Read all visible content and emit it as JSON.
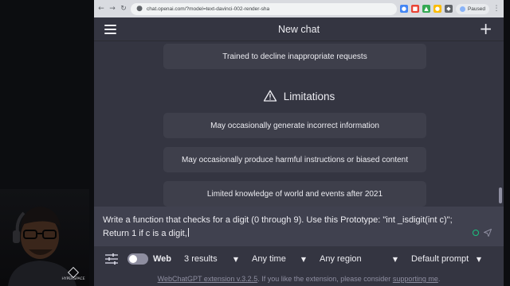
{
  "browser": {
    "url": "chat.openai.com/?model=text-davinci-002-render-sha",
    "profile_status": "Paused"
  },
  "header": {
    "title": "New chat"
  },
  "capabilities": {
    "last_item": "Trained to decline inappropriate requests"
  },
  "limitations": {
    "heading": "Limitations",
    "items": [
      "May occasionally generate incorrect information",
      "May occasionally produce harmful instructions or biased content",
      "Limited knowledge of world and events after 2021"
    ]
  },
  "prompt": {
    "text_line1": "Write a function that checks for a digit (0 through 9). Use this Prototype: \"int _isdigit(int c)\";",
    "text_line2": "Return 1 if c is a digit,"
  },
  "toolbar": {
    "web_label": "Web",
    "results": "3 results",
    "time": "Any time",
    "region": "Any region",
    "prompt_mode": "Default prompt"
  },
  "footer": {
    "link_extension": "WebChatGPT extension v.3.2.5",
    "middle_text": ". If you like the extension, please consider ",
    "link_support": "supporting me",
    "end_text": "."
  },
  "watermark": {
    "text": "HYPERSPACE"
  },
  "colors": {
    "page_bg": "#343541",
    "card_bg": "#3e3f4b",
    "prompt_bg": "#40414f",
    "text": "#ececf1",
    "accent_green": "#19c37d"
  }
}
